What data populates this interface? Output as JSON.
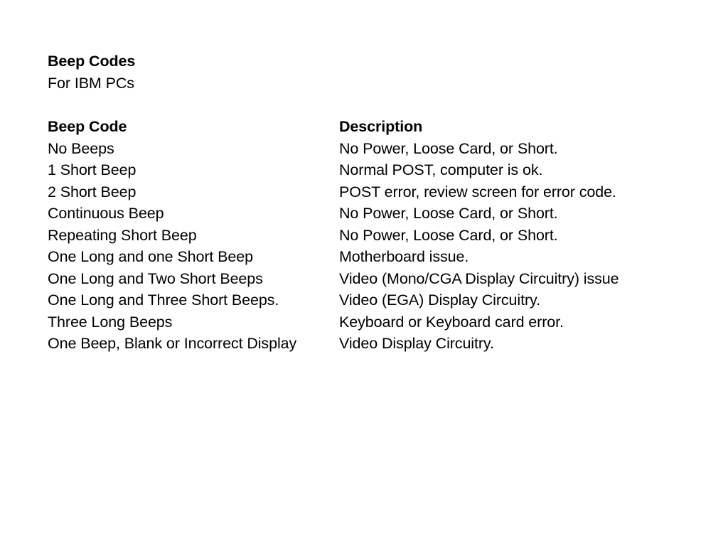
{
  "document": {
    "title": "Beep Codes",
    "subtitle": "For IBM PCs",
    "text_color": "#000000",
    "background_color": "#ffffff"
  },
  "table": {
    "headers": {
      "code": "Beep Code",
      "description": "Description"
    },
    "rows": [
      {
        "code": "No Beeps",
        "description": "No Power, Loose Card, or Short."
      },
      {
        "code": "1 Short Beep",
        "description": "Normal POST, computer is ok."
      },
      {
        "code": "2 Short Beep",
        "description": "POST error, review screen for error code."
      },
      {
        "code": "Continuous Beep",
        "description": "No Power, Loose Card, or Short."
      },
      {
        "code": "Repeating Short Beep",
        "description": "No Power, Loose Card, or Short."
      },
      {
        "code": "One Long and one Short Beep",
        "description": "Motherboard issue."
      },
      {
        "code": "One Long and Two Short Beeps",
        "description": "Video (Mono/CGA Display Circuitry) issue"
      },
      {
        "code": "One Long and Three Short Beeps.",
        "description": "Video (EGA) Display Circuitry."
      },
      {
        "code": "Three Long Beeps",
        "description": "Keyboard or Keyboard card error."
      },
      {
        "code": "One Beep, Blank or Incorrect Display",
        "description": "Video Display Circuitry."
      }
    ]
  }
}
